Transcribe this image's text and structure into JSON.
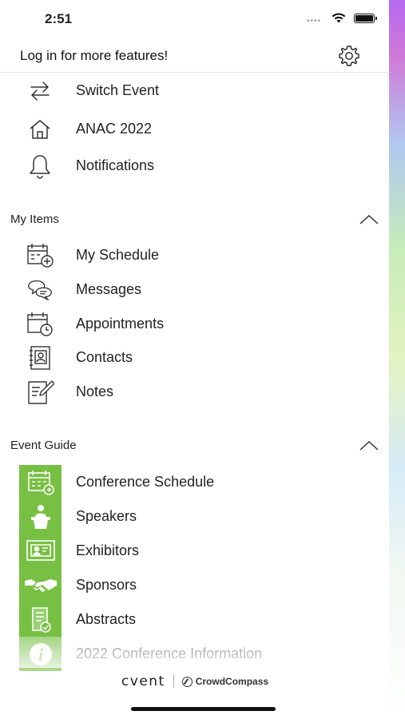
{
  "status_bar": {
    "time": "2:51",
    "signal_dots": "••••"
  },
  "header": {
    "login_text": "Log in for more features!",
    "settings_icon": "gear-icon"
  },
  "top_menu": [
    {
      "label": "Switch Event",
      "icon": "swap-arrows-icon"
    },
    {
      "label": "ANAC 2022",
      "icon": "home-icon"
    },
    {
      "label": "Notifications",
      "icon": "bell-icon"
    }
  ],
  "my_items": {
    "title": "My Items",
    "items": [
      {
        "label": "My Schedule",
        "icon": "calendar-add-icon"
      },
      {
        "label": "Messages",
        "icon": "chat-bubbles-icon"
      },
      {
        "label": "Appointments",
        "icon": "calendar-clock-icon"
      },
      {
        "label": "Contacts",
        "icon": "contact-book-icon"
      },
      {
        "label": "Notes",
        "icon": "note-pencil-icon"
      }
    ]
  },
  "event_guide": {
    "title": "Event Guide",
    "items": [
      {
        "label": "Conference Schedule",
        "icon": "calendar-tile-icon"
      },
      {
        "label": "Speakers",
        "icon": "podium-icon"
      },
      {
        "label": "Exhibitors",
        "icon": "booth-icon"
      },
      {
        "label": "Sponsors",
        "icon": "handshake-icon"
      },
      {
        "label": "Abstracts",
        "icon": "document-check-icon"
      },
      {
        "label": "2022 Conference Information",
        "icon": "info-icon"
      }
    ]
  },
  "footer": {
    "brand": "cvent",
    "partner": "CrowdCompass"
  },
  "colors": {
    "guide_tile": "#77c043",
    "text": "#222222"
  }
}
